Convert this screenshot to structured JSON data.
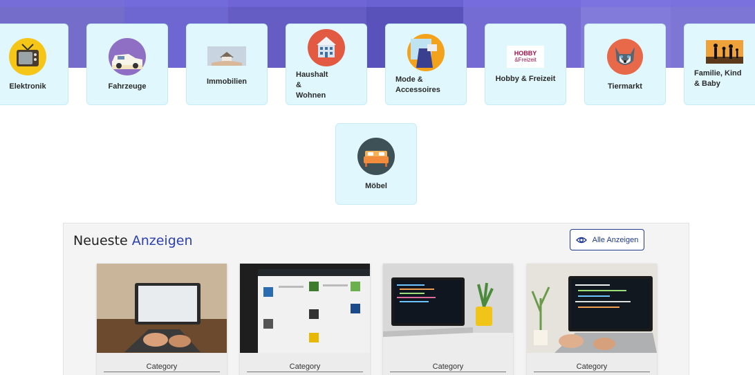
{
  "categories": [
    {
      "label": "Elektronik",
      "icon": "tv-icon"
    },
    {
      "label": "Fahrzeuge",
      "icon": "car-icon"
    },
    {
      "label": "Immobilien",
      "icon": "house-hand-icon"
    },
    {
      "label": "Haushalt & Wohnen",
      "icon": "building-icon"
    },
    {
      "label": "Mode & Accessoires",
      "icon": "fashion-icon"
    },
    {
      "label": "Hobby & Freizeit",
      "icon": "hobby-logo-icon",
      "logo_text": [
        "HOBBY",
        "&Freizeit"
      ]
    },
    {
      "label": "Tiermarkt",
      "icon": "husky-icon"
    },
    {
      "label": "Familie, Kind & Baby",
      "icon": "family-silhouette-icon"
    },
    {
      "label": "Möbel",
      "icon": "bed-icon"
    }
  ],
  "latest": {
    "title_plain": "Neueste",
    "title_accent": "Anzeigen",
    "all_button": "Alle Anzeigen",
    "all_button_icon": "eye-icon",
    "cards": [
      {
        "category": "Category",
        "image": "laptop-hands-photo"
      },
      {
        "category": "Category",
        "image": "wordpress-dashboard-photo"
      },
      {
        "category": "Category",
        "image": "laptop-code-plant-photo"
      },
      {
        "category": "Category",
        "image": "laptop-typing-code-photo"
      }
    ]
  },
  "colors": {
    "card_bg": "#e0f8fd",
    "accent": "#2b3fb0",
    "button_border": "#1f3a8f",
    "hero_overlay": "#6b62c8"
  }
}
